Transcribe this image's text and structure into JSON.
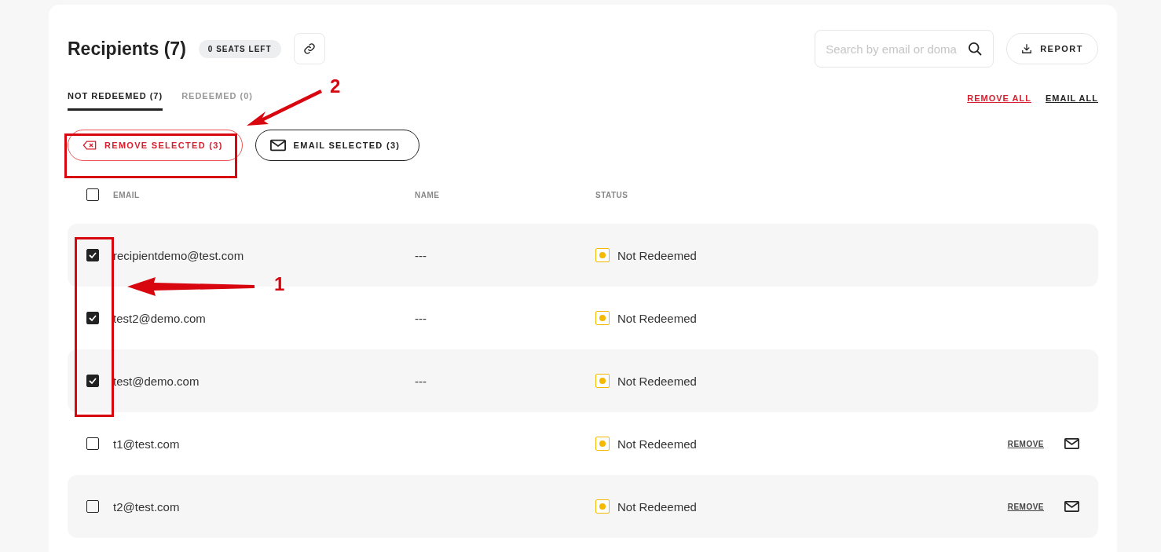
{
  "header": {
    "title": "Recipients (7)",
    "seats_badge": "0 SEATS LEFT",
    "search": {
      "placeholder": "Search by email or doma"
    },
    "report_button": "REPORT"
  },
  "tabs": [
    {
      "label": "NOT REDEEMED (7)",
      "selected": true
    },
    {
      "label": "REDEEMED (0)",
      "selected": false
    }
  ],
  "bulk_links": [
    {
      "label": "REMOVE ALL",
      "kind": "danger"
    },
    {
      "label": "EMAIL ALL",
      "kind": "plain"
    }
  ],
  "bulk_buttons": [
    {
      "label": "REMOVE SELECTED (3)",
      "kind": "remove"
    },
    {
      "label": "EMAIL SELECTED (3)",
      "kind": "email"
    }
  ],
  "table": {
    "select_all_checked": false,
    "columns": [
      "EMAIL",
      "NAME",
      "STATUS"
    ],
    "rows": [
      {
        "email": "recipientdemo@test.com",
        "name": "---",
        "status": "Not Redeemed",
        "checked": true
      },
      {
        "email": "test2@demo.com",
        "name": "---",
        "status": "Not Redeemed",
        "checked": true
      },
      {
        "email": "test@demo.com",
        "name": "---",
        "status": "Not Redeemed",
        "checked": true
      },
      {
        "email": "t1@test.com",
        "status": "Not Redeemed",
        "checked": false,
        "remove_action": "REMOVE"
      },
      {
        "email": "t2@test.com",
        "status": "Not Redeemed",
        "checked": false,
        "remove_action": "REMOVE"
      }
    ]
  },
  "annotations": [
    {
      "label": "2",
      "kind": "button-callout"
    },
    {
      "label": "1",
      "kind": "checkbox-callout"
    }
  ]
}
